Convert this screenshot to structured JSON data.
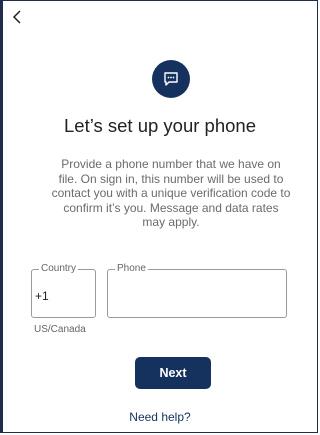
{
  "header": {
    "back_icon": "chevron-left-icon"
  },
  "badge": {
    "icon": "chat-message-icon",
    "color": "#15325f"
  },
  "main": {
    "title": "Let’s set up your phone",
    "description": "Provide a phone number that we have on file. On sign in, this number will be used to contact you with a unique verification code to confirm it’s you. Message and data rates may apply."
  },
  "form": {
    "country_label": "Country",
    "country_value": "+1",
    "country_caption": "US/Canada",
    "phone_label": "Phone",
    "phone_value": "",
    "phone_placeholder": ""
  },
  "actions": {
    "next_label": "Next",
    "help_label": "Need help?"
  },
  "colors": {
    "accent": "#15325f",
    "border": "#9a9a9a"
  }
}
